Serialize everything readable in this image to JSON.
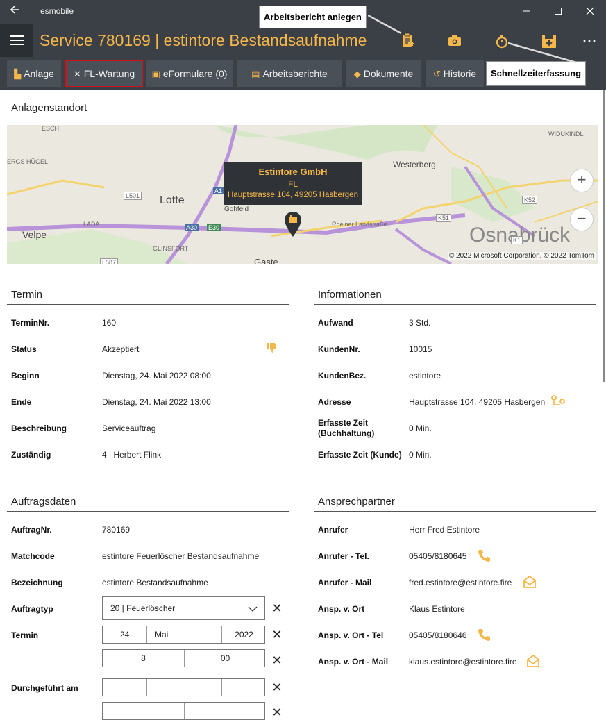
{
  "titlebar": {
    "app_name": "esmobile"
  },
  "header": {
    "title": "Service 780169  |  estintore Bestandsaufnahme"
  },
  "tabs": [
    {
      "label": "Anlage",
      "icon": "building-icon"
    },
    {
      "label": "FL-Wartung",
      "icon": "tools-icon"
    },
    {
      "label": "eFormulare (0)",
      "icon": "clipboard-check-icon"
    },
    {
      "label": "Arbeitsberichte",
      "icon": "clipboard-icon"
    },
    {
      "label": "Dokumente",
      "icon": "documents-icon"
    },
    {
      "label": "Historie",
      "icon": "history-icon"
    }
  ],
  "tooltips": {
    "arbeitsbericht": "Arbeitsbericht anlegen",
    "schnellzeit": "Schnellzeiterfassung"
  },
  "map_section": {
    "title": "Anlagenstandort",
    "popup": {
      "name": "Estintore GmbH",
      "line2": "FL",
      "address": "Hauptstrasse 104, 49205 Hasbergen"
    },
    "labels": {
      "lotte": "Lotte",
      "velpe": "Velpe",
      "westerberg": "Westerberg",
      "osnabrueck": "Osnabrück",
      "gohfeld": "Gohfeld",
      "gaste": "Gaste",
      "rheiner": "Rheiner Landstraße",
      "ergs": "ERGS HÜGEL",
      "lada": "LADA",
      "glinsfort": "GLINSFORT",
      "widukind": "WIDUKINDL",
      "esch": "ESCH",
      "a1": "A1",
      "a30": "A30",
      "e30": "E30",
      "l501": "L501",
      "k52": "K52",
      "k51": "K51",
      "k1": "K1",
      "l587": "L587"
    },
    "copyright": "© 2022 Microsoft Corporation, © 2022 TomTom"
  },
  "termin": {
    "title": "Termin",
    "rows": [
      {
        "label": "TerminNr.",
        "value": "160"
      },
      {
        "label": "Status",
        "value": "Akzeptiert"
      },
      {
        "label": "Beginn",
        "value": "Dienstag, 24. Mai 2022 08:00"
      },
      {
        "label": "Ende",
        "value": "Dienstag, 24. Mai 2022 13:00"
      },
      {
        "label": "Beschreibung",
        "value": "Serviceauftrag"
      },
      {
        "label": "Zuständig",
        "value": "4  |  Herbert Flink"
      }
    ]
  },
  "informationen": {
    "title": "Informationen",
    "rows": [
      {
        "label": "Aufwand",
        "value": "3 Std."
      },
      {
        "label": "KundenNr.",
        "value": "10015"
      },
      {
        "label": "KundenBez.",
        "value": "estintore"
      },
      {
        "label": "Adresse",
        "value": "Hauptstrasse 104, 49205 Hasbergen"
      },
      {
        "label": "Erfasste Zeit (Buchhaltung)",
        "value": "0 Min."
      },
      {
        "label": "Erfasste Zeit (Kunde)",
        "value": "0 Min."
      }
    ]
  },
  "auftragsdaten": {
    "title": "Auftragsdaten",
    "rows": [
      {
        "label": "AuftragNr.",
        "value": "780169"
      },
      {
        "label": "Matchcode",
        "value": "estintore Feuerlöscher Bestandsaufnahme"
      },
      {
        "label": "Bezeichnung",
        "value": "estintore Bestandsaufnahme"
      },
      {
        "label": "Auftragtyp",
        "value": "20  |  Feuerlöscher"
      },
      {
        "label": "Termin"
      },
      {
        "label": "Durchgeführt am"
      }
    ],
    "termin_date": {
      "day": "24",
      "month": "Mai",
      "year": "2022"
    },
    "termin_time": {
      "hour": "8",
      "minute": "00"
    }
  },
  "ansprechpartner": {
    "title": "Ansprechpartner",
    "rows": [
      {
        "label": "Anrufer",
        "value": "Herr Fred Estintore"
      },
      {
        "label": "Anrufer - Tel.",
        "value": "05405/8180645"
      },
      {
        "label": "Anrufer - Mail",
        "value": "fred.estintore@estintore.fire"
      },
      {
        "label": "Ansp. v. Ort",
        "value": "Klaus Estintore"
      },
      {
        "label": "Ansp. v. Ort - Tel",
        "value": "05405/8180646"
      },
      {
        "label": "Ansp. v. Ort - Mail",
        "value": "klaus.estintore@estintore.fire"
      }
    ]
  },
  "colors": {
    "accent": "#f5b64a",
    "header": "#3b4046",
    "active_border": "#d0131b"
  }
}
